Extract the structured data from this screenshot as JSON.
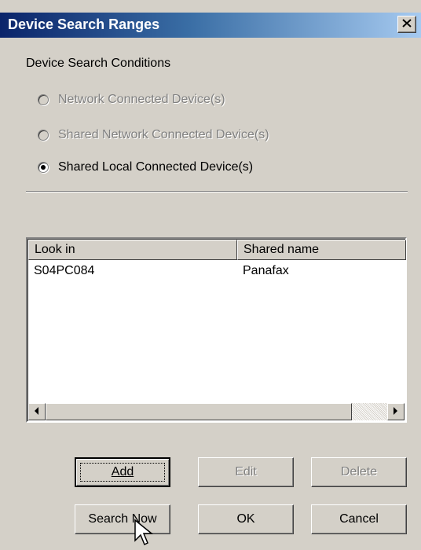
{
  "dialog": {
    "title": "Device Search Ranges",
    "close_label": "✕"
  },
  "conditions": {
    "label": "Device Search Conditions",
    "options": [
      {
        "label": "Network Connected Device(s)",
        "selected": false,
        "disabled": true
      },
      {
        "label": "Shared Network Connected Device(s)",
        "selected": false,
        "disabled": true
      },
      {
        "label": "Shared Local Connected Device(s)",
        "selected": true,
        "disabled": false
      }
    ]
  },
  "list": {
    "columns": [
      "Look in",
      "Shared name"
    ],
    "rows": [
      {
        "look_in": "S04PC084",
        "shared_name": "Panafax"
      }
    ]
  },
  "buttons": {
    "add": "Add",
    "edit": "Edit",
    "delete": "Delete",
    "search_now": "Search Now",
    "ok": "OK",
    "cancel": "Cancel"
  },
  "colors": {
    "title_start": "#0a246a",
    "title_end": "#a6caf0",
    "face": "#d4d0c8"
  }
}
